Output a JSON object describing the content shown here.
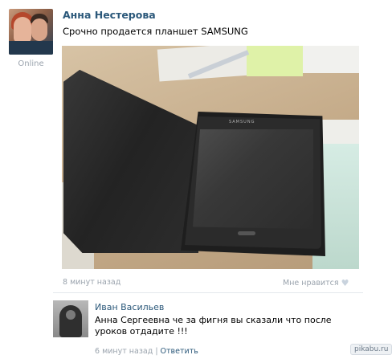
{
  "post": {
    "author": "Анна Нестерова",
    "status": "Online",
    "text": "Срочно продается планшет SAMSUNG",
    "photo_logo": "SAMSUNG",
    "time": "8 минут назад",
    "like_label": "Мне нравится"
  },
  "comment": {
    "author": "Иван Васильев",
    "text": "Анна Сергеевна че за фигня вы сказали что после уроков отдадите !!!",
    "time": "6 минут назад",
    "separator": "|",
    "reply_label": "Ответить"
  },
  "watermark": "pikabu.ru",
  "colors": {
    "link": "#2b587a",
    "muted": "#9aa3ad",
    "divider": "#e4e8ed"
  }
}
